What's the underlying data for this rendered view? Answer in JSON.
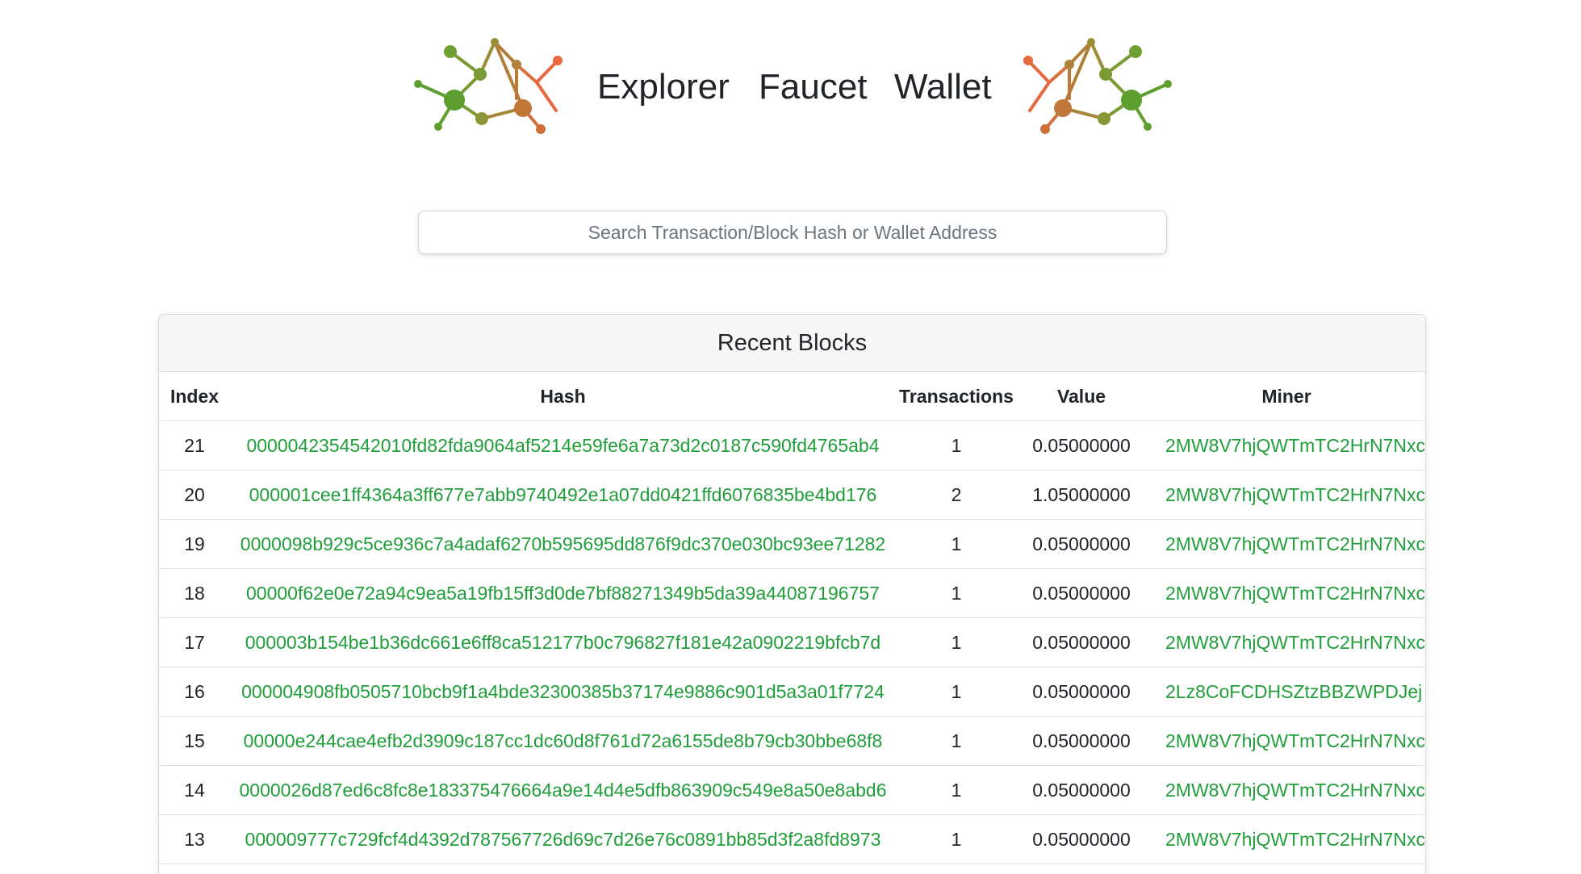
{
  "nav": {
    "explorer": "Explorer",
    "faucet": "Faucet",
    "wallet": "Wallet"
  },
  "search": {
    "placeholder": "Search Transaction/Block Hash or Wallet Address"
  },
  "recent_blocks": {
    "title": "Recent Blocks",
    "columns": {
      "index": "Index",
      "hash": "Hash",
      "transactions": "Transactions",
      "value": "Value",
      "miner": "Miner"
    },
    "rows": [
      {
        "index": "21",
        "hash": "0000042354542010fd82fda9064af5214e59fe6a7a73d2c0187c590fd4765ab4",
        "transactions": "1",
        "value": "0.05000000",
        "miner": "2MW8V7hjQWTmTC2HrN7Nxc"
      },
      {
        "index": "20",
        "hash": "000001cee1ff4364a3ff677e7abb9740492e1a07dd0421ffd6076835be4bd176",
        "transactions": "2",
        "value": "1.05000000",
        "miner": "2MW8V7hjQWTmTC2HrN7Nxc"
      },
      {
        "index": "19",
        "hash": "0000098b929c5ce936c7a4adaf6270b595695dd876f9dc370e030bc93ee71282",
        "transactions": "1",
        "value": "0.05000000",
        "miner": "2MW8V7hjQWTmTC2HrN7Nxc"
      },
      {
        "index": "18",
        "hash": "00000f62e0e72a94c9ea5a19fb15ff3d0de7bf88271349b5da39a44087196757",
        "transactions": "1",
        "value": "0.05000000",
        "miner": "2MW8V7hjQWTmTC2HrN7Nxc"
      },
      {
        "index": "17",
        "hash": "000003b154be1b36dc661e6ff8ca512177b0c796827f181e42a0902219bfcb7d",
        "transactions": "1",
        "value": "0.05000000",
        "miner": "2MW8V7hjQWTmTC2HrN7Nxc"
      },
      {
        "index": "16",
        "hash": "000004908fb0505710bcb9f1a4bde32300385b37174e9886c901d5a3a01f7724",
        "transactions": "1",
        "value": "0.05000000",
        "miner": "2Lz8CoFCDHSZtzBBZWPDJej"
      },
      {
        "index": "15",
        "hash": "00000e244cae4efb2d3909c187cc1dc60d8f761d72a6155de8b79cb30bbe68f8",
        "transactions": "1",
        "value": "0.05000000",
        "miner": "2MW8V7hjQWTmTC2HrN7Nxc"
      },
      {
        "index": "14",
        "hash": "0000026d87ed6c8fc8e183375476664a9e14d4e5dfb863909c549e8a50e8abd6",
        "transactions": "1",
        "value": "0.05000000",
        "miner": "2MW8V7hjQWTmTC2HrN7Nxc"
      },
      {
        "index": "13",
        "hash": "000009777c729fcf4d4392d787567726d69c7d26e76c0891bb85d3f2a8fd8973",
        "transactions": "1",
        "value": "0.05000000",
        "miner": "2MW8V7hjQWTmTC2HrN7Nxc"
      }
    ]
  },
  "colors": {
    "link": "#1f9e3a",
    "logo_green": "#5e9e2f",
    "logo_olive": "#9a8f38",
    "logo_brown": "#c07838",
    "logo_orange": "#e8683f"
  }
}
